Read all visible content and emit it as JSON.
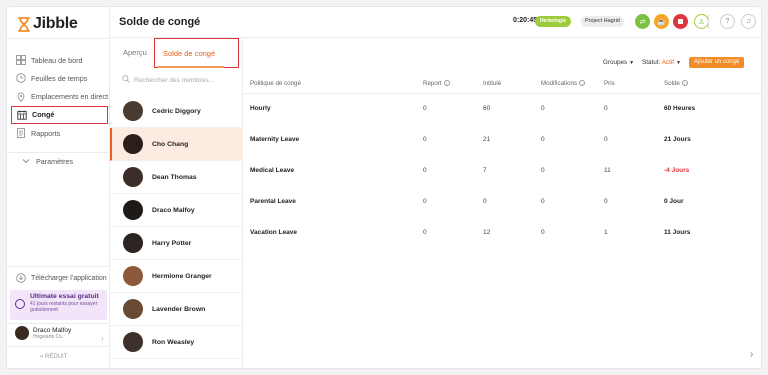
{
  "brand": {
    "name": "Jibble"
  },
  "sidebar": {
    "items": [
      {
        "label": "Tableau de bord",
        "icon": "dashboard-icon"
      },
      {
        "label": "Feuilles de temps",
        "icon": "clock-icon"
      },
      {
        "label": "Emplacements en direct",
        "icon": "location-pin-icon"
      },
      {
        "label": "Congé",
        "icon": "calendar-icon",
        "active": true
      },
      {
        "label": "Rapports",
        "icon": "report-icon"
      }
    ],
    "settings_label": "Paramètres",
    "download_label": "Télécharger l'application",
    "trial": {
      "title": "Ultimate essai gratuit",
      "subtitle": "41 jours restants pour essayer gratuitement"
    },
    "user": {
      "name": "Draco Malfoy",
      "org": "Hogwarts Co."
    },
    "collapse_label": "RÉDUIT"
  },
  "header": {
    "title": "Solde de congé",
    "timer": "0:20:45",
    "clock_badge": "Herbologie",
    "project": "Project Hagrid",
    "colors": {
      "green": "#7cc142",
      "orange": "#f6a623",
      "red": "#e0343c"
    }
  },
  "tabs": {
    "overview": "Aperçu",
    "balance": "Solde de congé"
  },
  "members": {
    "search_placeholder": "Rechercher des membres...",
    "list": [
      {
        "name": "Cedric Diggory",
        "selected": false
      },
      {
        "name": "Cho Chang",
        "selected": true
      },
      {
        "name": "Dean Thomas",
        "selected": false
      },
      {
        "name": "Draco Malfoy",
        "selected": false
      },
      {
        "name": "Harry Potter",
        "selected": false
      },
      {
        "name": "Hermione Granger",
        "selected": false
      },
      {
        "name": "Lavender Brown",
        "selected": false
      },
      {
        "name": "Ron Weasley",
        "selected": false
      }
    ]
  },
  "toolbar": {
    "groups_label": "Groupes",
    "status_label": "Statut:",
    "status_value": "Actif",
    "add_button": "Ajouter un congé"
  },
  "table": {
    "headers": {
      "policy": "Politique de congé",
      "carryover": "Report",
      "initial": "Intitulé",
      "modifications": "Modifications",
      "taken": "Pris",
      "balance": "Solde"
    },
    "rows": [
      {
        "policy": "Hourly",
        "carryover": "0",
        "initial": "60",
        "modifications": "0",
        "taken": "0",
        "balance": "60 Heures",
        "negative": false
      },
      {
        "policy": "Maternity Leave",
        "carryover": "0",
        "initial": "21",
        "modifications": "0",
        "taken": "0",
        "balance": "21 Jours",
        "negative": false
      },
      {
        "policy": "Medical Leave",
        "carryover": "0",
        "initial": "7",
        "modifications": "0",
        "taken": "11",
        "balance": "-4 Jours",
        "negative": true
      },
      {
        "policy": "Parental Leave",
        "carryover": "0",
        "initial": "0",
        "modifications": "0",
        "taken": "0",
        "balance": "0 Jour",
        "negative": false
      },
      {
        "policy": "Vacation Leave",
        "carryover": "0",
        "initial": "12",
        "modifications": "0",
        "taken": "1",
        "balance": "11 Jours",
        "negative": false
      }
    ]
  }
}
